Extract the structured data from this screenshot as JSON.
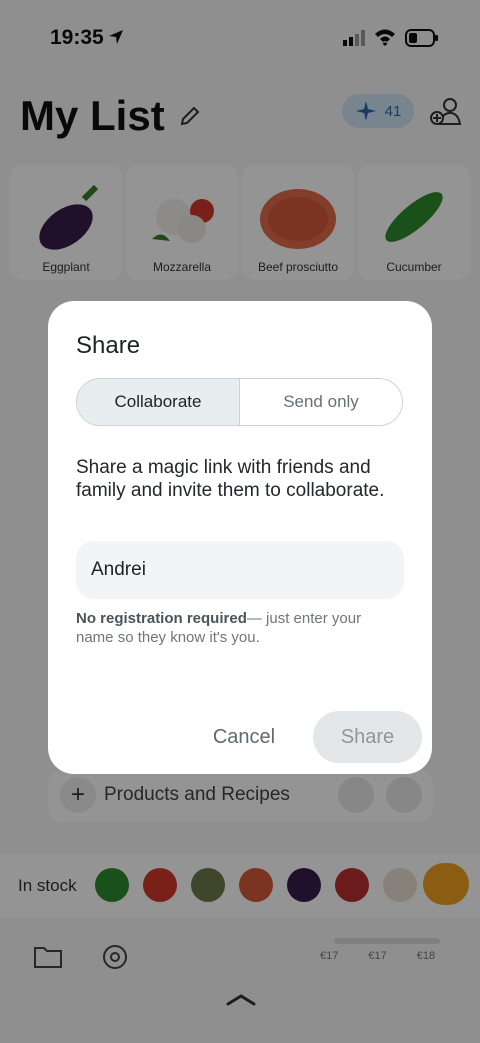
{
  "status_bar": {
    "time": "19:35"
  },
  "header": {
    "title": "My List",
    "credits": "41"
  },
  "product_strip": [
    {
      "label": "Eggplant"
    },
    {
      "label": "Mozzarella"
    },
    {
      "label": "Beef prosciutto"
    },
    {
      "label": "Cucumber"
    }
  ],
  "add_bar": {
    "label": "Products and Recipes"
  },
  "in_stock": {
    "label": "In stock"
  },
  "price_scale": [
    "€17",
    "€17",
    "€18"
  ],
  "modal": {
    "title": "Share",
    "tabs": [
      {
        "label": "Collaborate",
        "active": true
      },
      {
        "label": "Send only",
        "active": false
      }
    ],
    "description": "Share a magic link with friends and family and invite them to collaborate.",
    "name_value": "Andrei",
    "note_bold": "No registration required",
    "note_rest": "— just enter your name so they know it's you.",
    "cancel_label": "Cancel",
    "share_label": "Share"
  }
}
